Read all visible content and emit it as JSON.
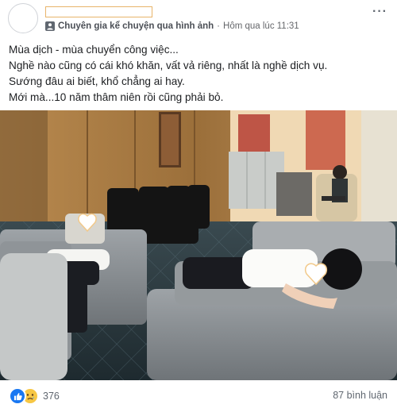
{
  "post": {
    "group_name": "Chuyên gia kể chuyện qua hình ảnh",
    "separator": "·",
    "timestamp": "Hôm qua lúc 11:31",
    "more_label": "···",
    "lines": [
      "Mùa dịch - mùa chuyển công việc...",
      "Nghề nào cũng có cái khó khăn, vất vả riêng, nhất là nghề dịch vụ.",
      "Sướng đâu ai biết, khổ chẳng ai hay.",
      "Mới mà...10 năm thâm niên rồi cũng phải bỏ."
    ]
  },
  "photo": {
    "description_icon": "photo"
  },
  "footer": {
    "reaction_count": "376",
    "comments": "87 bình luận",
    "reactions": [
      "like-icon",
      "sad-icon"
    ]
  },
  "colors": {
    "like": "#1877f2",
    "sad": "#f7c744",
    "meta": "#65676b"
  }
}
